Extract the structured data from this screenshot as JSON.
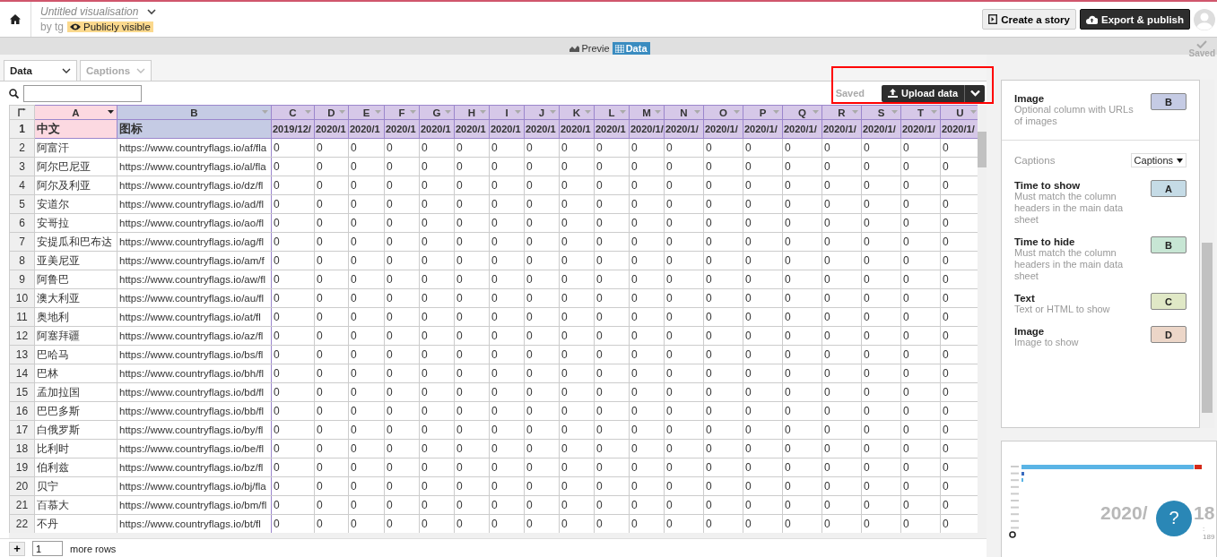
{
  "header": {
    "title": "Untitled visualisation",
    "author": "by tg",
    "visibility": "Publicly visible",
    "buttons": [
      {
        "kind": "story",
        "label": "Create a story"
      },
      {
        "kind": "export",
        "label": "Export & publish"
      }
    ]
  },
  "view_tabs": [
    {
      "label": "Previe",
      "selected": false
    },
    {
      "label": "Data",
      "selected": true
    }
  ],
  "saved_corner": "Saved",
  "sheet_tabs": [
    {
      "label": "Data",
      "selected": true
    },
    {
      "label": "Captions",
      "selected": false
    }
  ],
  "sheet_status": "Saved",
  "upload_button": "Upload data",
  "columns": [
    {
      "letter": "A",
      "color": "#fcd9e1"
    },
    {
      "letter": "B",
      "color": "#c5cbe4"
    },
    {
      "letter": "C",
      "color": "#d6c8e8"
    },
    {
      "letter": "D",
      "color": "#d6c8e8"
    },
    {
      "letter": "E",
      "color": "#d6c8e8"
    },
    {
      "letter": "F",
      "color": "#d6c8e8"
    },
    {
      "letter": "G",
      "color": "#d6c8e8"
    },
    {
      "letter": "H",
      "color": "#d6c8e8"
    },
    {
      "letter": "I",
      "color": "#d6c8e8"
    },
    {
      "letter": "J",
      "color": "#d6c8e8"
    },
    {
      "letter": "K",
      "color": "#d6c8e8"
    },
    {
      "letter": "L",
      "color": "#d6c8e8"
    },
    {
      "letter": "M",
      "color": "#d6c8e8"
    },
    {
      "letter": "N",
      "color": "#d6c8e8"
    },
    {
      "letter": "O",
      "color": "#d6c8e8"
    },
    {
      "letter": "P",
      "color": "#d6c8e8"
    },
    {
      "letter": "Q",
      "color": "#d6c8e8"
    },
    {
      "letter": "R",
      "color": "#d6c8e8"
    },
    {
      "letter": "S",
      "color": "#d6c8e8"
    },
    {
      "letter": "T",
      "color": "#d6c8e8"
    },
    {
      "letter": "U",
      "color": "#d6c8e8"
    }
  ],
  "header_row": {
    "num": "1",
    "cells": [
      "中文",
      "图标",
      "2019/12/",
      "2020/1",
      "2020/1",
      "2020/1",
      "2020/1",
      "2020/1",
      "2020/1",
      "2020/1",
      "2020/1",
      "2020/1",
      "2020/1/",
      "2020/1/",
      "2020/1/",
      "2020/1/",
      "2020/1/",
      "2020/1/",
      "2020/1/",
      "2020/1/",
      "2020/1/"
    ]
  },
  "rows": [
    {
      "num": "2",
      "cells": [
        "阿富汗",
        "https://www.countryflags.io/af/fla",
        "0",
        "0",
        "0",
        "0",
        "0",
        "0",
        "0",
        "0",
        "0",
        "0",
        "0",
        "0",
        "0",
        "0",
        "0",
        "0",
        "0",
        "0",
        "0"
      ]
    },
    {
      "num": "3",
      "cells": [
        "阿尔巴尼亚",
        "https://www.countryflags.io/al/fla",
        "0",
        "0",
        "0",
        "0",
        "0",
        "0",
        "0",
        "0",
        "0",
        "0",
        "0",
        "0",
        "0",
        "0",
        "0",
        "0",
        "0",
        "0",
        "0"
      ]
    },
    {
      "num": "4",
      "cells": [
        "阿尔及利亚",
        "https://www.countryflags.io/dz/fl",
        "0",
        "0",
        "0",
        "0",
        "0",
        "0",
        "0",
        "0",
        "0",
        "0",
        "0",
        "0",
        "0",
        "0",
        "0",
        "0",
        "0",
        "0",
        "0"
      ]
    },
    {
      "num": "5",
      "cells": [
        "安道尔",
        "https://www.countryflags.io/ad/fl",
        "0",
        "0",
        "0",
        "0",
        "0",
        "0",
        "0",
        "0",
        "0",
        "0",
        "0",
        "0",
        "0",
        "0",
        "0",
        "0",
        "0",
        "0",
        "0"
      ]
    },
    {
      "num": "6",
      "cells": [
        "安哥拉",
        "https://www.countryflags.io/ao/fl",
        "0",
        "0",
        "0",
        "0",
        "0",
        "0",
        "0",
        "0",
        "0",
        "0",
        "0",
        "0",
        "0",
        "0",
        "0",
        "0",
        "0",
        "0",
        "0"
      ]
    },
    {
      "num": "7",
      "cells": [
        "安提瓜和巴布达",
        "https://www.countryflags.io/ag/fl",
        "0",
        "0",
        "0",
        "0",
        "0",
        "0",
        "0",
        "0",
        "0",
        "0",
        "0",
        "0",
        "0",
        "0",
        "0",
        "0",
        "0",
        "0",
        "0"
      ]
    },
    {
      "num": "8",
      "cells": [
        "亚美尼亚",
        "https://www.countryflags.io/am/f",
        "0",
        "0",
        "0",
        "0",
        "0",
        "0",
        "0",
        "0",
        "0",
        "0",
        "0",
        "0",
        "0",
        "0",
        "0",
        "0",
        "0",
        "0",
        "0"
      ]
    },
    {
      "num": "9",
      "cells": [
        "阿鲁巴",
        "https://www.countryflags.io/aw/fl",
        "0",
        "0",
        "0",
        "0",
        "0",
        "0",
        "0",
        "0",
        "0",
        "0",
        "0",
        "0",
        "0",
        "0",
        "0",
        "0",
        "0",
        "0",
        "0"
      ]
    },
    {
      "num": "10",
      "cells": [
        "澳大利亚",
        "https://www.countryflags.io/au/fl",
        "0",
        "0",
        "0",
        "0",
        "0",
        "0",
        "0",
        "0",
        "0",
        "0",
        "0",
        "0",
        "0",
        "0",
        "0",
        "0",
        "0",
        "0",
        "0"
      ]
    },
    {
      "num": "11",
      "cells": [
        "奥地利",
        "https://www.countryflags.io/at/fl",
        "0",
        "0",
        "0",
        "0",
        "0",
        "0",
        "0",
        "0",
        "0",
        "0",
        "0",
        "0",
        "0",
        "0",
        "0",
        "0",
        "0",
        "0",
        "0"
      ]
    },
    {
      "num": "12",
      "cells": [
        "阿塞拜疆",
        "https://www.countryflags.io/az/fl",
        "0",
        "0",
        "0",
        "0",
        "0",
        "0",
        "0",
        "0",
        "0",
        "0",
        "0",
        "0",
        "0",
        "0",
        "0",
        "0",
        "0",
        "0",
        "0"
      ]
    },
    {
      "num": "13",
      "cells": [
        "巴哈马",
        "https://www.countryflags.io/bs/fl",
        "0",
        "0",
        "0",
        "0",
        "0",
        "0",
        "0",
        "0",
        "0",
        "0",
        "0",
        "0",
        "0",
        "0",
        "0",
        "0",
        "0",
        "0",
        "0"
      ]
    },
    {
      "num": "14",
      "cells": [
        "巴林",
        "https://www.countryflags.io/bh/fl",
        "0",
        "0",
        "0",
        "0",
        "0",
        "0",
        "0",
        "0",
        "0",
        "0",
        "0",
        "0",
        "0",
        "0",
        "0",
        "0",
        "0",
        "0",
        "0"
      ]
    },
    {
      "num": "15",
      "cells": [
        "孟加拉国",
        "https://www.countryflags.io/bd/fl",
        "0",
        "0",
        "0",
        "0",
        "0",
        "0",
        "0",
        "0",
        "0",
        "0",
        "0",
        "0",
        "0",
        "0",
        "0",
        "0",
        "0",
        "0",
        "0"
      ]
    },
    {
      "num": "16",
      "cells": [
        "巴巴多斯",
        "https://www.countryflags.io/bb/fl",
        "0",
        "0",
        "0",
        "0",
        "0",
        "0",
        "0",
        "0",
        "0",
        "0",
        "0",
        "0",
        "0",
        "0",
        "0",
        "0",
        "0",
        "0",
        "0"
      ]
    },
    {
      "num": "17",
      "cells": [
        "白俄罗斯",
        "https://www.countryflags.io/by/fl",
        "0",
        "0",
        "0",
        "0",
        "0",
        "0",
        "0",
        "0",
        "0",
        "0",
        "0",
        "0",
        "0",
        "0",
        "0",
        "0",
        "0",
        "0",
        "0"
      ]
    },
    {
      "num": "18",
      "cells": [
        "比利时",
        "https://www.countryflags.io/be/fl",
        "0",
        "0",
        "0",
        "0",
        "0",
        "0",
        "0",
        "0",
        "0",
        "0",
        "0",
        "0",
        "0",
        "0",
        "0",
        "0",
        "0",
        "0",
        "0"
      ]
    },
    {
      "num": "19",
      "cells": [
        "伯利兹",
        "https://www.countryflags.io/bz/fl",
        "0",
        "0",
        "0",
        "0",
        "0",
        "0",
        "0",
        "0",
        "0",
        "0",
        "0",
        "0",
        "0",
        "0",
        "0",
        "0",
        "0",
        "0",
        "0"
      ]
    },
    {
      "num": "20",
      "cells": [
        "贝宁",
        "https://www.countryflags.io/bj/fla",
        "0",
        "0",
        "0",
        "0",
        "0",
        "0",
        "0",
        "0",
        "0",
        "0",
        "0",
        "0",
        "0",
        "0",
        "0",
        "0",
        "0",
        "0",
        "0"
      ]
    },
    {
      "num": "21",
      "cells": [
        "百慕大",
        "https://www.countryflags.io/bm/fl",
        "0",
        "0",
        "0",
        "0",
        "0",
        "0",
        "0",
        "0",
        "0",
        "0",
        "0",
        "0",
        "0",
        "0",
        "0",
        "0",
        "0",
        "0",
        "0"
      ]
    },
    {
      "num": "22",
      "cells": [
        "不丹",
        "https://www.countryflags.io/bt/fl",
        "0",
        "0",
        "0",
        "0",
        "0",
        "0",
        "0",
        "0",
        "0",
        "0",
        "0",
        "0",
        "0",
        "0",
        "0",
        "0",
        "0",
        "0",
        "0"
      ]
    }
  ],
  "more_rows": {
    "plus": "+",
    "value": "1",
    "label": "more rows"
  },
  "panel": {
    "image_field": {
      "title": "Image",
      "hint": "Optional column with URLs of images",
      "column": "B",
      "color": "#c5cbe4"
    },
    "captions_label": "Captions",
    "captions_select": "Captions",
    "fields": [
      {
        "title": "Time to show",
        "hint": "Must match the column headers in the main data sheet",
        "column": "A",
        "color": "#c5dbe6"
      },
      {
        "title": "Time to hide",
        "hint": "Must match the column headers in the main data sheet",
        "column": "B",
        "color": "#c7e6d4"
      },
      {
        "title": "Text",
        "hint": "Text or HTML to show",
        "column": "C",
        "color": "#e0e8c6"
      },
      {
        "title": "Image",
        "hint": "Image to show",
        "column": "D",
        "color": "#ecd6c8"
      }
    ]
  },
  "preview": {
    "date_start": "2020/",
    "date_end": "18",
    "total": ": 189",
    "help": "?"
  }
}
